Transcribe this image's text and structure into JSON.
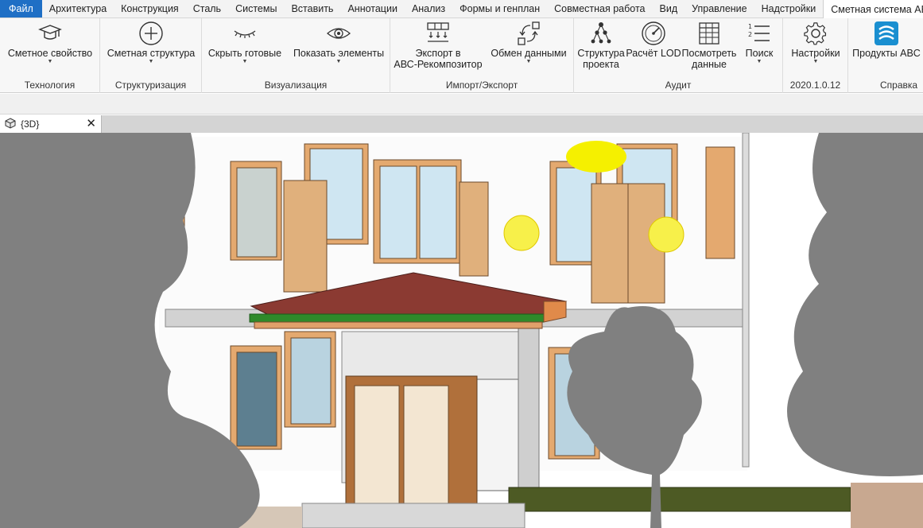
{
  "menu": {
    "tabs": [
      "Файл",
      "Архитектура",
      "Конструкция",
      "Сталь",
      "Системы",
      "Вставить",
      "Аннотации",
      "Анализ",
      "Формы и генплан",
      "Совместная работа",
      "Вид",
      "Управление",
      "Надстройки",
      "Сметная система ABC"
    ],
    "active_index": 13
  },
  "ribbon": {
    "panels": [
      {
        "title": "Технология",
        "buttons": [
          {
            "label": "Сметное свойство",
            "icon": "graduation-cap-icon",
            "dropdown": true
          }
        ]
      },
      {
        "title": "Структуризация",
        "buttons": [
          {
            "label": "Сметная структура",
            "icon": "plus-circle-icon",
            "dropdown": true
          }
        ]
      },
      {
        "title": "Визуализация",
        "buttons": [
          {
            "label": "Скрыть готовые",
            "icon": "eye-closed-icon",
            "dropdown": true
          },
          {
            "label": "Показать элементы",
            "icon": "eye-icon",
            "dropdown": true
          }
        ]
      },
      {
        "title": "Импорт/Экспорт",
        "buttons": [
          {
            "label": "Экспорт в",
            "label2": "АВС-Рекомпозитор",
            "icon": "export-grid-icon",
            "dropdown": false
          },
          {
            "label": "Обмен данными",
            "icon": "exchange-icon",
            "dropdown": true
          }
        ]
      },
      {
        "title": "Аудит",
        "buttons": [
          {
            "label": "Структура",
            "label2": "проекта",
            "icon": "hierarchy-icon",
            "dropdown": false
          },
          {
            "label": "Расчёт LOD",
            "icon": "gauge-icon",
            "dropdown": false
          },
          {
            "label": "Посмотреть",
            "label2": "данные",
            "icon": "table-icon",
            "dropdown": false
          },
          {
            "label": "Поиск",
            "icon": "numbered-list-icon",
            "dropdown": true
          }
        ]
      },
      {
        "title": "2020.1.0.12",
        "buttons": [
          {
            "label": "Настройки",
            "icon": "gear-icon",
            "dropdown": true
          }
        ]
      },
      {
        "title": "Справка",
        "buttons": [
          {
            "label": "Продукты ABC",
            "icon": "abc-logo-icon",
            "dropdown": false
          }
        ]
      }
    ]
  },
  "view_tab": {
    "title": "{3D}",
    "close": "✕"
  },
  "colors": {
    "file_tab": "#1f6fc5",
    "ribbon_bg": "#f7f7f7",
    "abc_logo": "#1a8fd0",
    "wall_wood": "#e0b07c",
    "roof": "#8b3a32",
    "tree": "#808080"
  }
}
